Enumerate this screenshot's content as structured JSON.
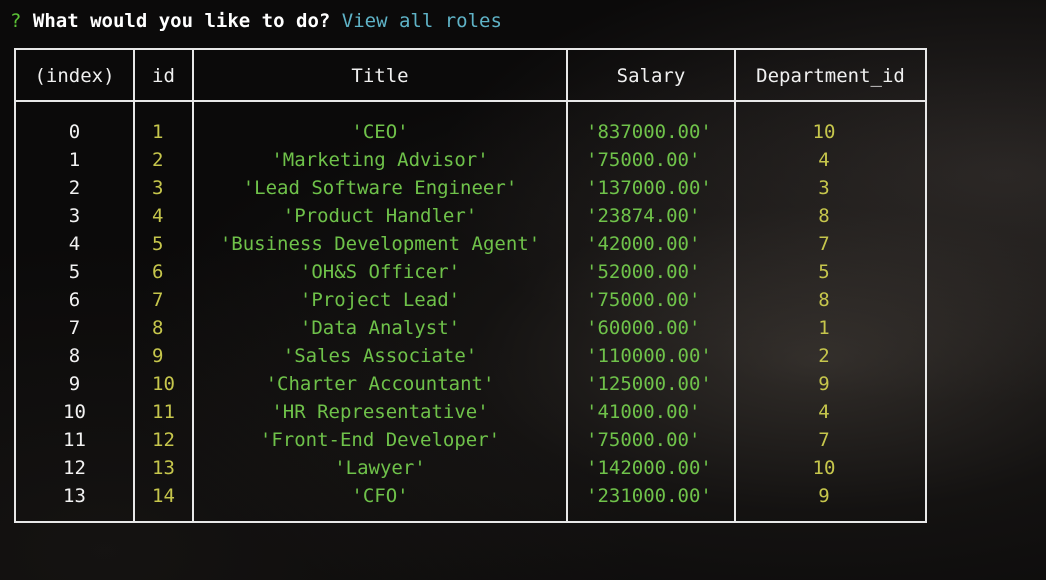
{
  "prompt": {
    "marker": "?",
    "question": "What would you like to do?",
    "answer": "View all roles"
  },
  "table": {
    "headers": [
      "(index)",
      "id",
      "Title",
      "Salary",
      "Department_id"
    ],
    "rows": [
      {
        "index": "0",
        "id": "1",
        "title": "'CEO'",
        "salary": "'837000.00'",
        "dept": "10"
      },
      {
        "index": "1",
        "id": "2",
        "title": "'Marketing Advisor'",
        "salary": "'75000.00'",
        "dept": "4"
      },
      {
        "index": "2",
        "id": "3",
        "title": "'Lead Software Engineer'",
        "salary": "'137000.00'",
        "dept": "3"
      },
      {
        "index": "3",
        "id": "4",
        "title": "'Product Handler'",
        "salary": "'23874.00'",
        "dept": "8"
      },
      {
        "index": "4",
        "id": "5",
        "title": "'Business Development Agent'",
        "salary": "'42000.00'",
        "dept": "7"
      },
      {
        "index": "5",
        "id": "6",
        "title": "'OH&S Officer'",
        "salary": "'52000.00'",
        "dept": "5"
      },
      {
        "index": "6",
        "id": "7",
        "title": "'Project Lead'",
        "salary": "'75000.00'",
        "dept": "8"
      },
      {
        "index": "7",
        "id": "8",
        "title": "'Data Analyst'",
        "salary": "'60000.00'",
        "dept": "1"
      },
      {
        "index": "8",
        "id": "9",
        "title": "'Sales Associate'",
        "salary": "'110000.00'",
        "dept": "2"
      },
      {
        "index": "9",
        "id": "10",
        "title": "'Charter Accountant'",
        "salary": "'125000.00'",
        "dept": "9"
      },
      {
        "index": "10",
        "id": "11",
        "title": "'HR Representative'",
        "salary": "'41000.00'",
        "dept": "4"
      },
      {
        "index": "11",
        "id": "12",
        "title": "'Front-End Developer'",
        "salary": "'75000.00'",
        "dept": "7"
      },
      {
        "index": "12",
        "id": "13",
        "title": "'Lawyer'",
        "salary": "'142000.00'",
        "dept": "10"
      },
      {
        "index": "13",
        "id": "14",
        "title": "'CFO'",
        "salary": "'231000.00'",
        "dept": "9"
      }
    ]
  },
  "colors": {
    "prompt_marker": "#5bc236",
    "answer": "#5fb3c7",
    "string_value": "#6fc24a",
    "number_value": "#c6c64c"
  }
}
